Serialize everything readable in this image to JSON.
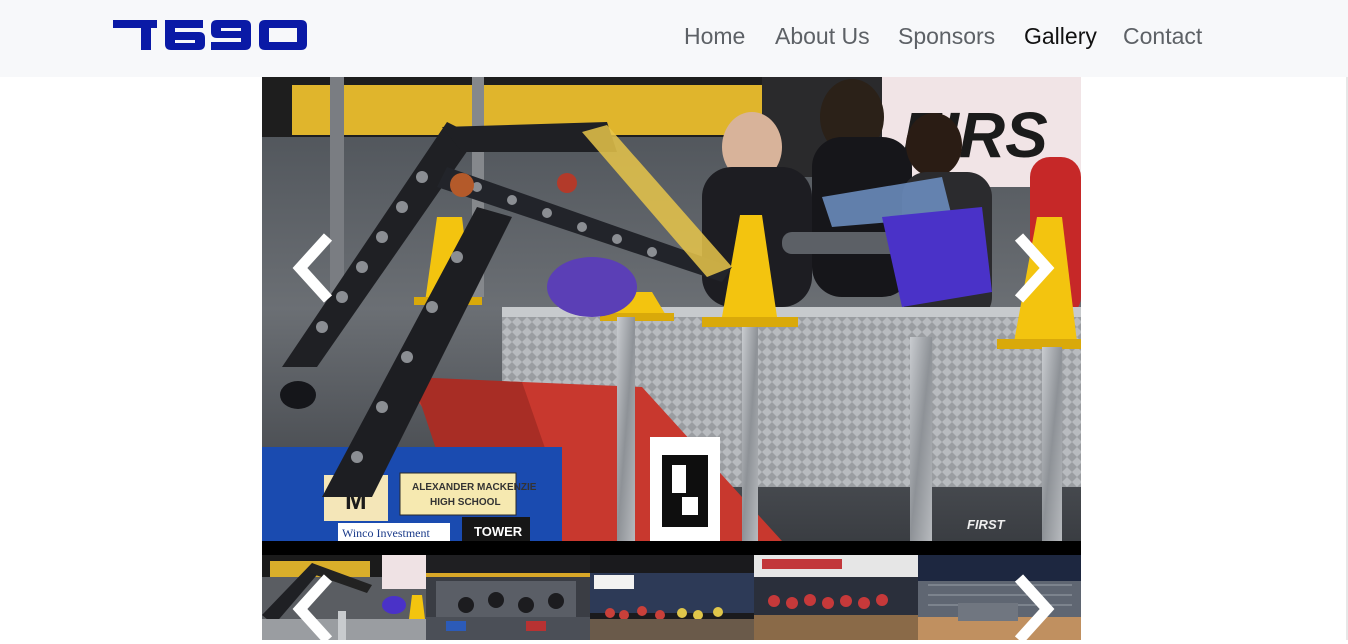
{
  "brand": {
    "logo_text": "7690",
    "logo_color": "#0a1aa6"
  },
  "nav": {
    "items": [
      {
        "label": "Home",
        "active": false
      },
      {
        "label": "About Us",
        "active": false
      },
      {
        "label": "Sponsors",
        "active": false
      },
      {
        "label": "Gallery",
        "active": true
      },
      {
        "label": "Contact",
        "active": false
      }
    ]
  },
  "gallery": {
    "main_slide": {
      "signage": {
        "school_line1": "ALEXANDER MACKENZIE",
        "school_line2": "HIGH SCHOOL",
        "sponsor_sign": "Winco Investment",
        "tower_sign": "TOWER",
        "banner_text": "FIRS",
        "watermark": "FIRST"
      }
    },
    "thumbnails": [
      {
        "name": "thumb-robot-closeup"
      },
      {
        "name": "thumb-field-view"
      },
      {
        "name": "thumb-crowd-stands"
      },
      {
        "name": "thumb-team-group"
      },
      {
        "name": "thumb-arena-wide"
      }
    ],
    "controls": {
      "prev_icon": "chevron-left-icon",
      "next_icon": "chevron-right-icon"
    }
  },
  "colors": {
    "nav_bg": "#f7f8fa",
    "nav_text": "#5d6166",
    "nav_active_text": "#111111",
    "strip_bg": "#000000"
  }
}
